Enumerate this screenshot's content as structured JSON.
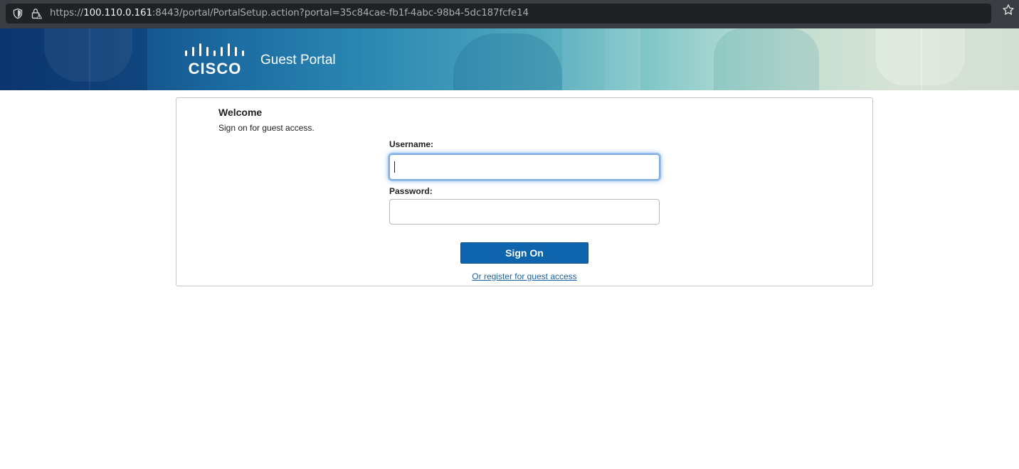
{
  "browser": {
    "url_scheme": "https://",
    "url_host": "100.110.0.161",
    "url_rest": ":8443/portal/PortalSetup.action?portal=35c84cae-fb1f-4abc-98b4-5dc187fcfe14",
    "icons": [
      "shield-icon",
      "lock-icon",
      "star-icon"
    ]
  },
  "header": {
    "logo_text": "CISCO",
    "portal_title": "Guest Portal"
  },
  "login": {
    "welcome_title": "Welcome",
    "welcome_subtitle": "Sign on for guest access.",
    "username_label": "Username:",
    "username_value": "",
    "password_label": "Password:",
    "password_value": "",
    "sign_on_label": "Sign On",
    "register_link": "Or register for guest access"
  },
  "colors": {
    "browser_bar": "#3a3e42",
    "url_field": "#1f2224",
    "primary_button": "#0e65ad",
    "link": "#1a5f9e",
    "focus_ring": "#66a3e8"
  }
}
